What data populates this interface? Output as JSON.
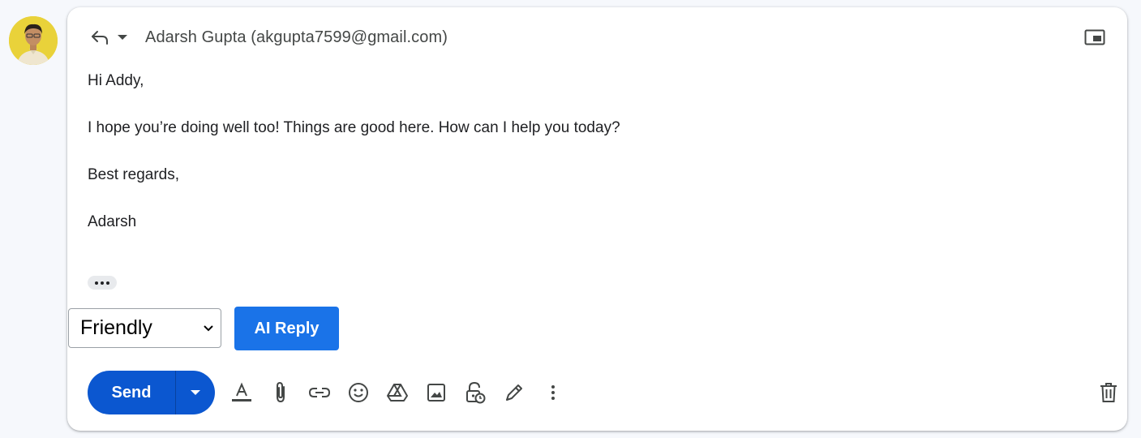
{
  "sender": {
    "avatar_icon": "user-avatar-photo"
  },
  "compose": {
    "reply_type_icon": "reply-arrow-icon",
    "recipient": "Adarsh Gupta (akgupta7599@gmail.com)",
    "popout_icon": "popout-window-icon",
    "body_lines": [
      "Hi Addy,",
      "I hope you’re doing well too! Things are good here. How can I help you today?",
      "Best regards,",
      "Adarsh"
    ],
    "trimmed_content_icon": "more-horiz-icon"
  },
  "ai_tools": {
    "tone_selected": "Friendly",
    "ai_reply_label": "AI Reply"
  },
  "toolbar": {
    "send_label": "Send",
    "icons": [
      "text-formatting-icon",
      "attach-icon",
      "link-icon",
      "emoji-icon",
      "drive-icon",
      "photo-icon",
      "confidential-lock-icon",
      "signature-pen-icon",
      "more-vert-icon"
    ],
    "discard_icon": "trash-icon"
  },
  "colors": {
    "send_button": "#0b57d0",
    "ai_reply_button": "#1a73e8",
    "avatar_bg": "#e9d23a"
  }
}
